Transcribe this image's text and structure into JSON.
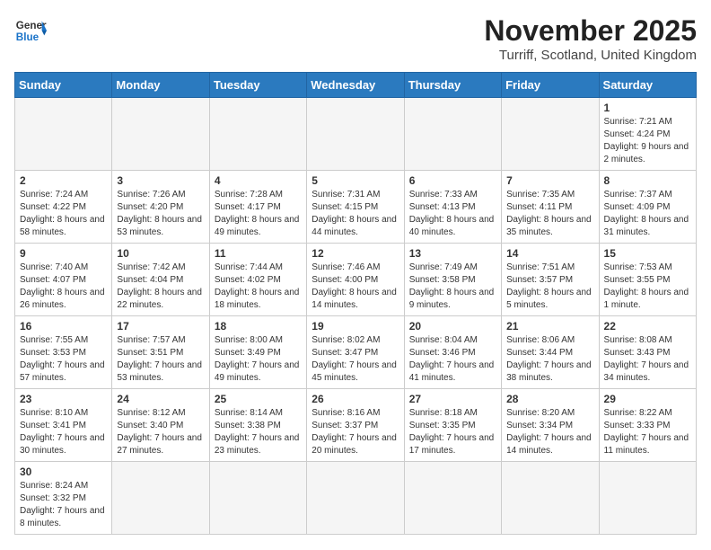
{
  "header": {
    "logo_general": "General",
    "logo_blue": "Blue",
    "title": "November 2025",
    "subtitle": "Turriff, Scotland, United Kingdom"
  },
  "weekdays": [
    "Sunday",
    "Monday",
    "Tuesday",
    "Wednesday",
    "Thursday",
    "Friday",
    "Saturday"
  ],
  "weeks": [
    [
      {
        "day": "",
        "info": ""
      },
      {
        "day": "",
        "info": ""
      },
      {
        "day": "",
        "info": ""
      },
      {
        "day": "",
        "info": ""
      },
      {
        "day": "",
        "info": ""
      },
      {
        "day": "",
        "info": ""
      },
      {
        "day": "1",
        "info": "Sunrise: 7:21 AM\nSunset: 4:24 PM\nDaylight: 9 hours\nand 2 minutes."
      }
    ],
    [
      {
        "day": "2",
        "info": "Sunrise: 7:24 AM\nSunset: 4:22 PM\nDaylight: 8 hours\nand 58 minutes."
      },
      {
        "day": "3",
        "info": "Sunrise: 7:26 AM\nSunset: 4:20 PM\nDaylight: 8 hours\nand 53 minutes."
      },
      {
        "day": "4",
        "info": "Sunrise: 7:28 AM\nSunset: 4:17 PM\nDaylight: 8 hours\nand 49 minutes."
      },
      {
        "day": "5",
        "info": "Sunrise: 7:31 AM\nSunset: 4:15 PM\nDaylight: 8 hours\nand 44 minutes."
      },
      {
        "day": "6",
        "info": "Sunrise: 7:33 AM\nSunset: 4:13 PM\nDaylight: 8 hours\nand 40 minutes."
      },
      {
        "day": "7",
        "info": "Sunrise: 7:35 AM\nSunset: 4:11 PM\nDaylight: 8 hours\nand 35 minutes."
      },
      {
        "day": "8",
        "info": "Sunrise: 7:37 AM\nSunset: 4:09 PM\nDaylight: 8 hours\nand 31 minutes."
      }
    ],
    [
      {
        "day": "9",
        "info": "Sunrise: 7:40 AM\nSunset: 4:07 PM\nDaylight: 8 hours\nand 26 minutes."
      },
      {
        "day": "10",
        "info": "Sunrise: 7:42 AM\nSunset: 4:04 PM\nDaylight: 8 hours\nand 22 minutes."
      },
      {
        "day": "11",
        "info": "Sunrise: 7:44 AM\nSunset: 4:02 PM\nDaylight: 8 hours\nand 18 minutes."
      },
      {
        "day": "12",
        "info": "Sunrise: 7:46 AM\nSunset: 4:00 PM\nDaylight: 8 hours\nand 14 minutes."
      },
      {
        "day": "13",
        "info": "Sunrise: 7:49 AM\nSunset: 3:58 PM\nDaylight: 8 hours\nand 9 minutes."
      },
      {
        "day": "14",
        "info": "Sunrise: 7:51 AM\nSunset: 3:57 PM\nDaylight: 8 hours\nand 5 minutes."
      },
      {
        "day": "15",
        "info": "Sunrise: 7:53 AM\nSunset: 3:55 PM\nDaylight: 8 hours\nand 1 minute."
      }
    ],
    [
      {
        "day": "16",
        "info": "Sunrise: 7:55 AM\nSunset: 3:53 PM\nDaylight: 7 hours\nand 57 minutes."
      },
      {
        "day": "17",
        "info": "Sunrise: 7:57 AM\nSunset: 3:51 PM\nDaylight: 7 hours\nand 53 minutes."
      },
      {
        "day": "18",
        "info": "Sunrise: 8:00 AM\nSunset: 3:49 PM\nDaylight: 7 hours\nand 49 minutes."
      },
      {
        "day": "19",
        "info": "Sunrise: 8:02 AM\nSunset: 3:47 PM\nDaylight: 7 hours\nand 45 minutes."
      },
      {
        "day": "20",
        "info": "Sunrise: 8:04 AM\nSunset: 3:46 PM\nDaylight: 7 hours\nand 41 minutes."
      },
      {
        "day": "21",
        "info": "Sunrise: 8:06 AM\nSunset: 3:44 PM\nDaylight: 7 hours\nand 38 minutes."
      },
      {
        "day": "22",
        "info": "Sunrise: 8:08 AM\nSunset: 3:43 PM\nDaylight: 7 hours\nand 34 minutes."
      }
    ],
    [
      {
        "day": "23",
        "info": "Sunrise: 8:10 AM\nSunset: 3:41 PM\nDaylight: 7 hours\nand 30 minutes."
      },
      {
        "day": "24",
        "info": "Sunrise: 8:12 AM\nSunset: 3:40 PM\nDaylight: 7 hours\nand 27 minutes."
      },
      {
        "day": "25",
        "info": "Sunrise: 8:14 AM\nSunset: 3:38 PM\nDaylight: 7 hours\nand 23 minutes."
      },
      {
        "day": "26",
        "info": "Sunrise: 8:16 AM\nSunset: 3:37 PM\nDaylight: 7 hours\nand 20 minutes."
      },
      {
        "day": "27",
        "info": "Sunrise: 8:18 AM\nSunset: 3:35 PM\nDaylight: 7 hours\nand 17 minutes."
      },
      {
        "day": "28",
        "info": "Sunrise: 8:20 AM\nSunset: 3:34 PM\nDaylight: 7 hours\nand 14 minutes."
      },
      {
        "day": "29",
        "info": "Sunrise: 8:22 AM\nSunset: 3:33 PM\nDaylight: 7 hours\nand 11 minutes."
      }
    ],
    [
      {
        "day": "30",
        "info": "Sunrise: 8:24 AM\nSunset: 3:32 PM\nDaylight: 7 hours\nand 8 minutes."
      },
      {
        "day": "",
        "info": ""
      },
      {
        "day": "",
        "info": ""
      },
      {
        "day": "",
        "info": ""
      },
      {
        "day": "",
        "info": ""
      },
      {
        "day": "",
        "info": ""
      },
      {
        "day": "",
        "info": ""
      }
    ]
  ]
}
